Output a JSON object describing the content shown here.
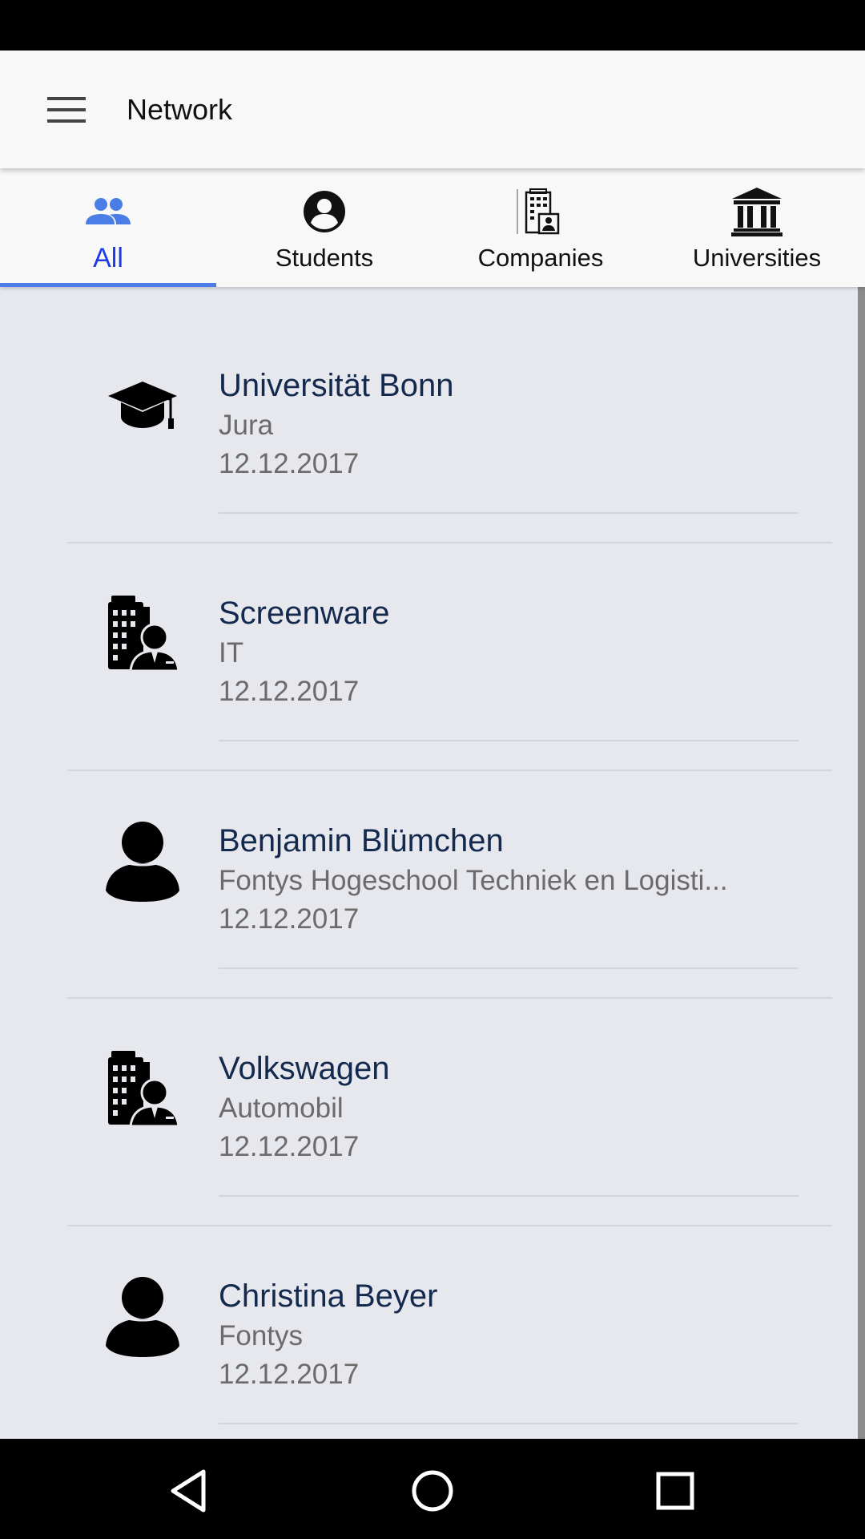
{
  "app_bar": {
    "title": "Network",
    "menu_icon": "hamburger-menu-icon"
  },
  "tabs": [
    {
      "label": "All",
      "icon": "people-icon",
      "active": true
    },
    {
      "label": "Students",
      "icon": "account-circle-icon",
      "active": false
    },
    {
      "label": "Companies",
      "icon": "company-building-icon",
      "active": false
    },
    {
      "label": "Universities",
      "icon": "university-building-icon",
      "active": false
    }
  ],
  "colors": {
    "active_tab": "#1c3ce8",
    "tab_indicator": "#4a7ee6",
    "item_title": "#14294e",
    "item_secondary": "#6b6b6b",
    "list_background": "#e6e8ee"
  },
  "network_items": [
    {
      "name": "Universität Bonn",
      "subtitle": "Jura",
      "date": "12.12.2017",
      "icon": "graduation-cap-icon"
    },
    {
      "name": "Screenware",
      "subtitle": "IT",
      "date": "12.12.2017",
      "icon": "company-person-icon"
    },
    {
      "name": "Benjamin Blümchen",
      "subtitle": "Fontys Hogeschool Techniek en Logisti...",
      "date": "12.12.2017",
      "icon": "person-icon"
    },
    {
      "name": "Volkswagen",
      "subtitle": "Automobil",
      "date": "12.12.2017",
      "icon": "company-person-icon"
    },
    {
      "name": "Christina Beyer",
      "subtitle": "Fontys",
      "date": "12.12.2017",
      "icon": "person-icon"
    }
  ],
  "nav_bar": {
    "back_icon": "back-triangle-icon",
    "home_icon": "home-circle-icon",
    "recents_icon": "recents-square-icon"
  }
}
